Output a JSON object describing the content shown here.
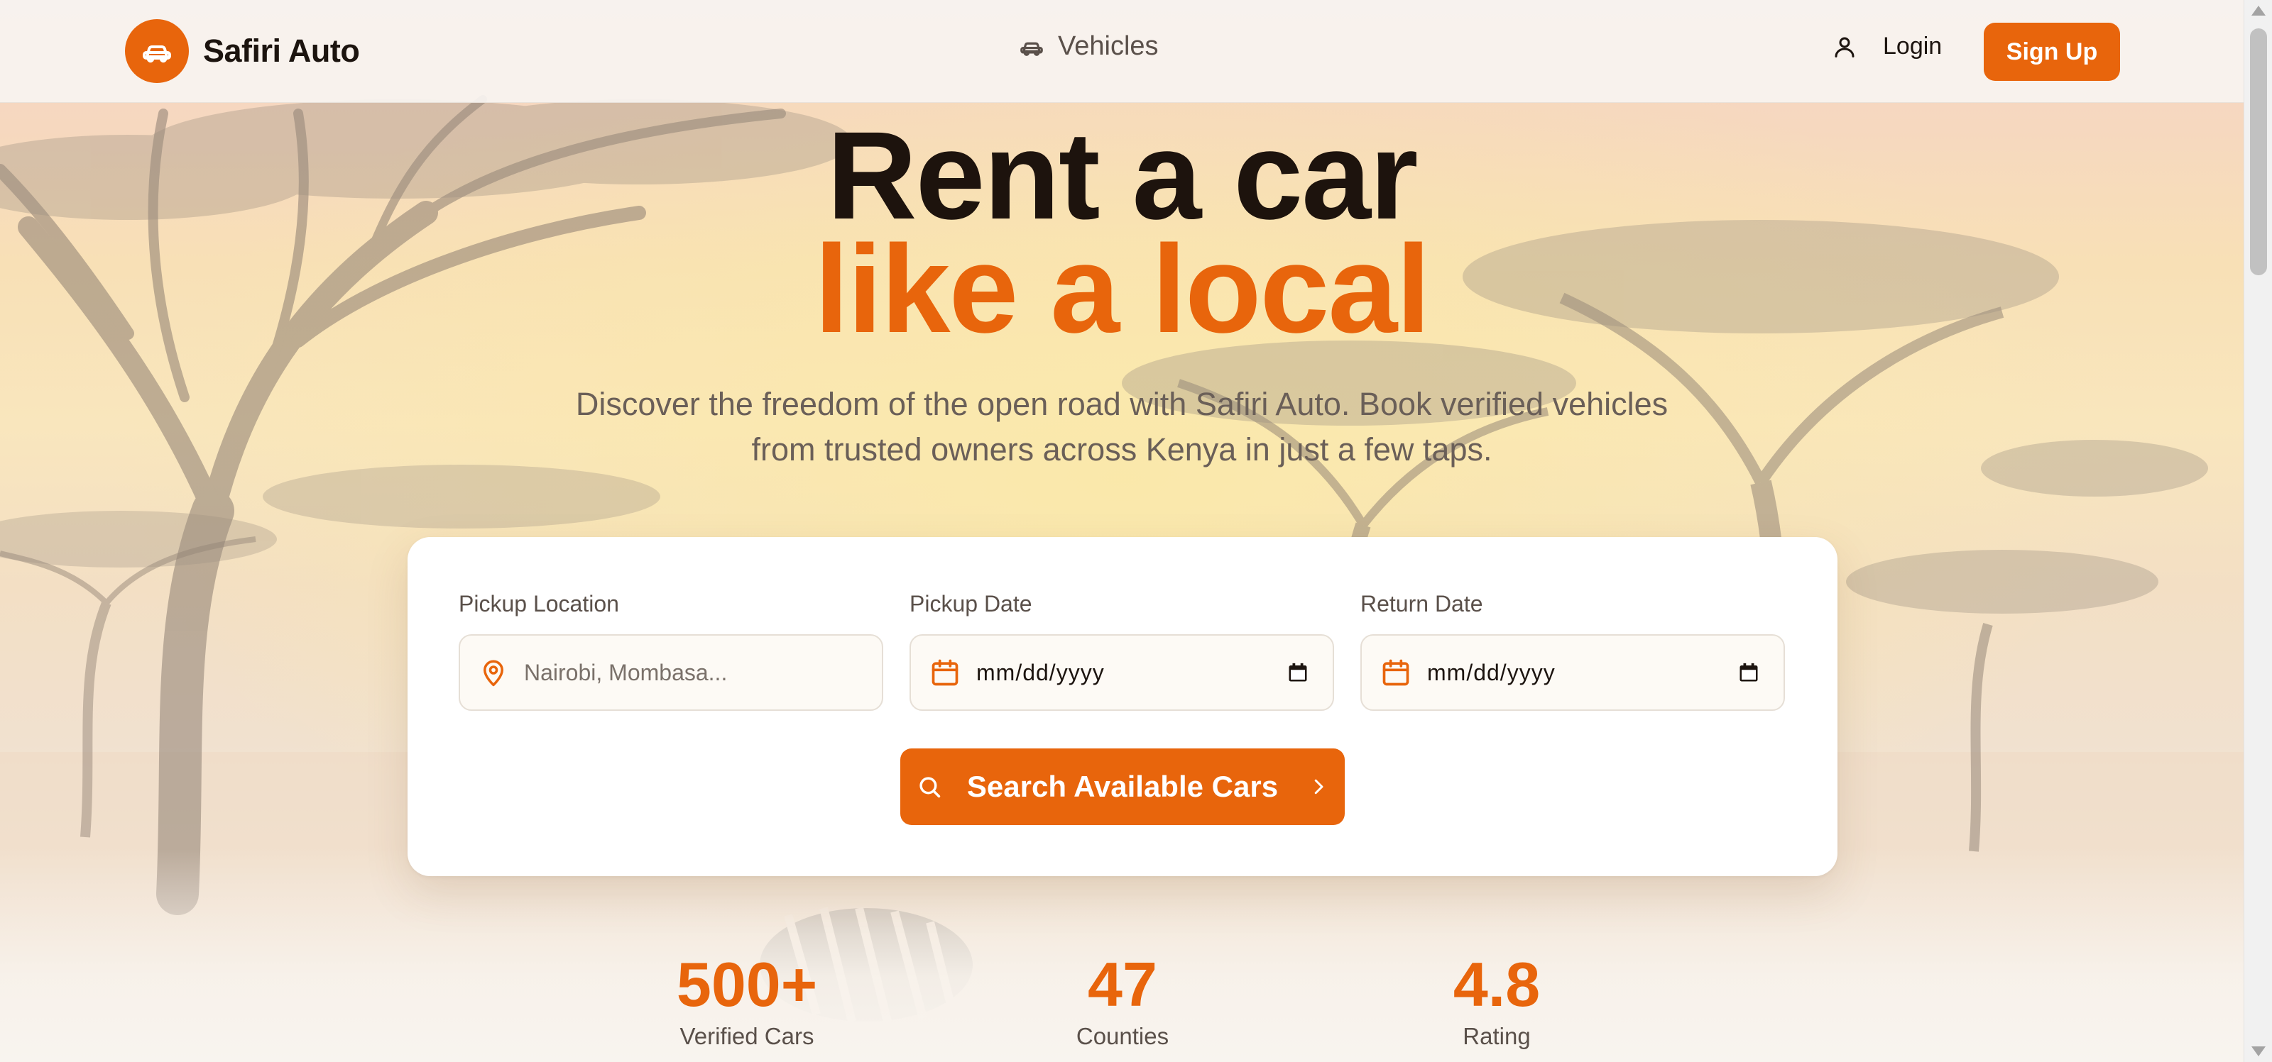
{
  "header": {
    "brand_name": "Safiri Auto",
    "nav_vehicles": "Vehicles",
    "login": "Login",
    "signup": "Sign Up"
  },
  "hero": {
    "title_line1": "Rent a car",
    "title_line2": "like a local",
    "subtitle": "Discover the freedom of the open road with Safiri Auto. Book verified vehicles from trusted owners across Kenya in just a few taps."
  },
  "search": {
    "pickup_location": {
      "label": "Pickup Location",
      "placeholder": "Nairobi, Mombasa..."
    },
    "pickup_date": {
      "label": "Pickup Date",
      "value": "mm/dd/yyyy"
    },
    "return_date": {
      "label": "Return Date",
      "value": "mm/dd/yyyy"
    },
    "button_label": "Search Available Cars"
  },
  "stats": [
    {
      "value": "500+",
      "label": "Verified Cars"
    },
    {
      "value": "47",
      "label": "Counties"
    },
    {
      "value": "4.8",
      "label": "Rating"
    }
  ],
  "colors": {
    "accent": "#e8650c",
    "text_dark": "#1d130d",
    "text_muted": "#6a5f58"
  },
  "icons": {
    "brand_logo": "car-icon",
    "nav_vehicles": "car-icon",
    "login": "user-icon",
    "pickup_location": "map-pin-icon",
    "pickup_date": "calendar-icon",
    "return_date": "calendar-icon",
    "search_button": "search-icon",
    "search_button_trailing": "chevron-right-icon"
  }
}
